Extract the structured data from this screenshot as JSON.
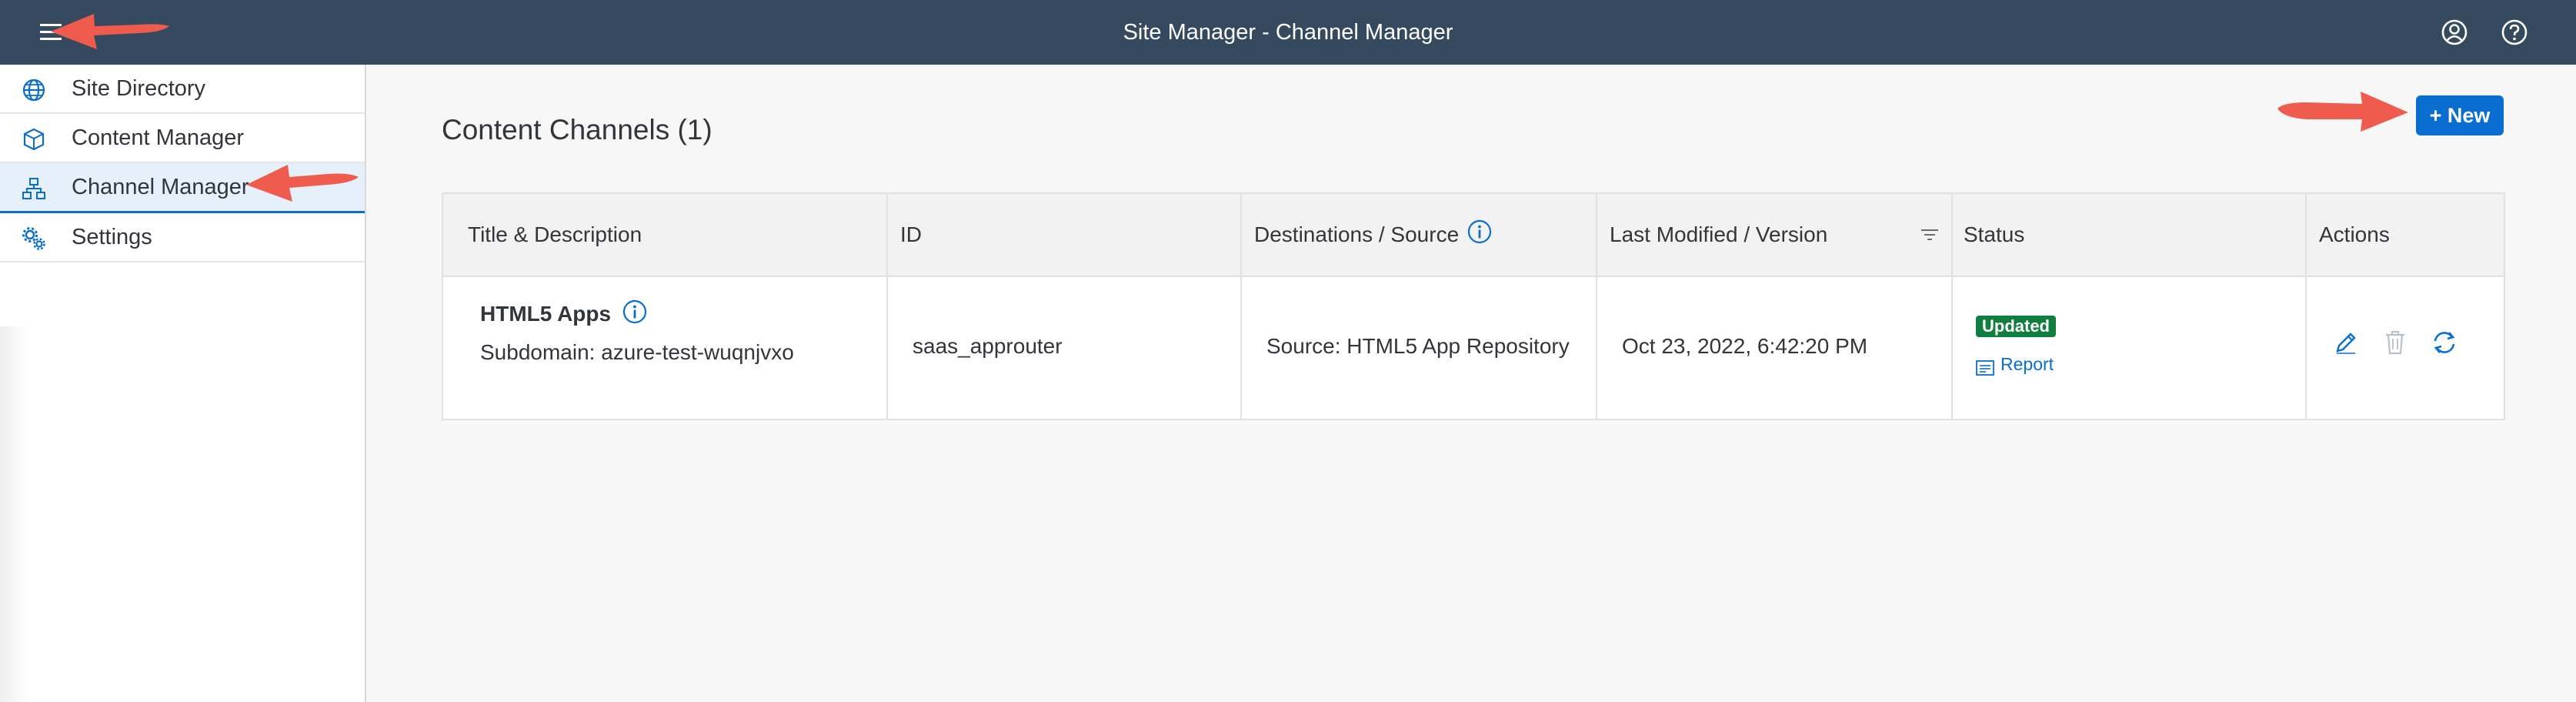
{
  "shell": {
    "title": "Site Manager - Channel Manager",
    "menu_icon": "hamburger-menu-icon",
    "user_icon": "user-profile-icon",
    "help_icon": "help-icon",
    "bg_color": "#354a5f"
  },
  "sidebar": {
    "items": [
      {
        "label": "Site Directory",
        "icon": "globe-icon",
        "selected": false
      },
      {
        "label": "Content Manager",
        "icon": "cube-icon",
        "selected": false
      },
      {
        "label": "Channel Manager",
        "icon": "hierarchy-icon",
        "selected": true
      },
      {
        "label": "Settings",
        "icon": "gears-icon",
        "selected": false
      }
    ]
  },
  "main": {
    "title": "Content Channels (1)",
    "new_button_label": "+ New"
  },
  "table": {
    "columns": [
      "Title & Description",
      "ID",
      "Destinations / Source",
      "Last Modified / Version",
      "Status",
      "Actions"
    ],
    "rows": [
      {
        "title": "HTML5 Apps",
        "description": "Subdomain: azure-test-wuqnjvxo",
        "id": "saas_approuter",
        "source": "Source: HTML5 App Repository",
        "modified": "Oct 23, 2022, 6:42:20 PM",
        "status": "Updated",
        "report_label": "Report"
      }
    ]
  },
  "colors": {
    "accent": "#0a6ed1",
    "status_positive": "#107e3e",
    "callout": "#ef5b4c"
  }
}
